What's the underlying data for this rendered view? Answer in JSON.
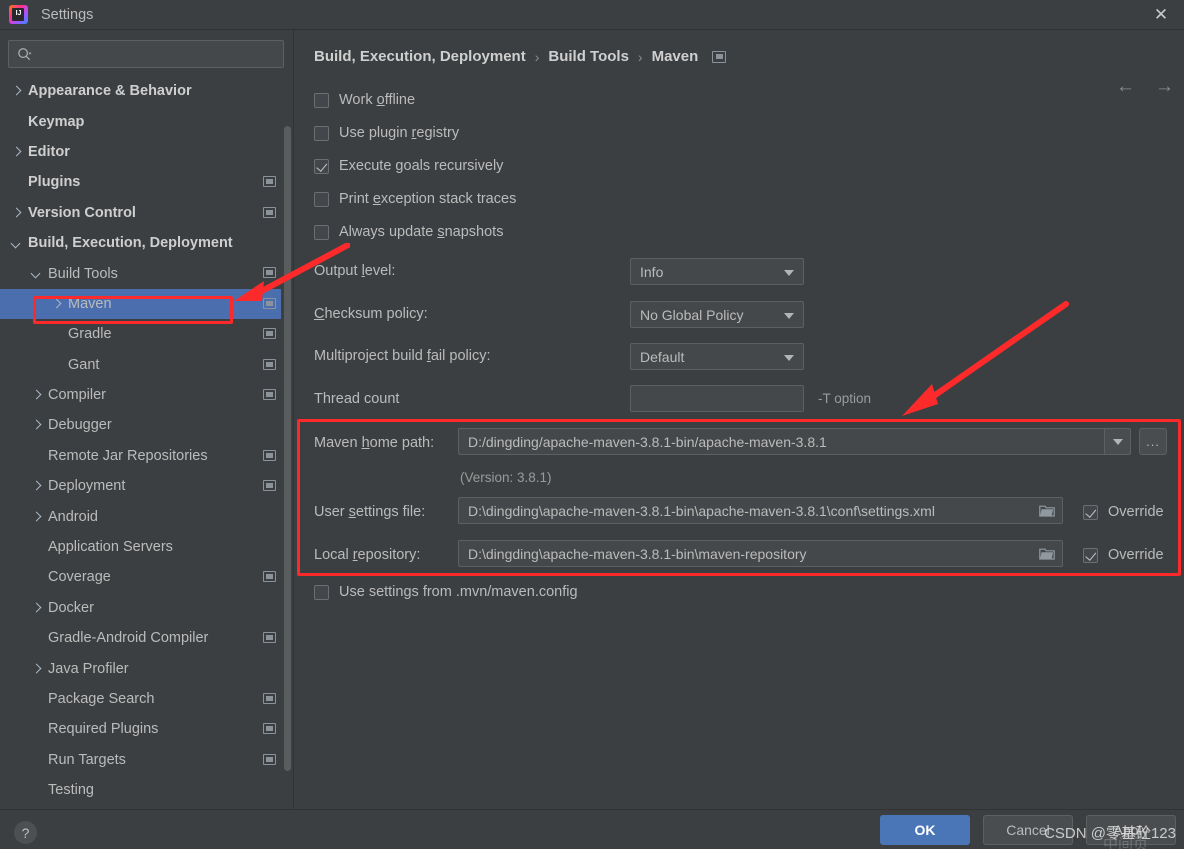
{
  "window": {
    "title": "Settings",
    "logo_text": "IJ",
    "close_label": "✕"
  },
  "sidebar": {
    "search": {
      "value": "",
      "placeholder": ""
    },
    "items": [
      {
        "label": "Appearance & Behavior",
        "indent": 0,
        "chev": "right",
        "bold": true,
        "proj": false,
        "selected": false
      },
      {
        "label": "Keymap",
        "indent": 0,
        "chev": "none",
        "bold": true,
        "proj": false,
        "selected": false
      },
      {
        "label": "Editor",
        "indent": 0,
        "chev": "right",
        "bold": true,
        "proj": false,
        "selected": false
      },
      {
        "label": "Plugins",
        "indent": 0,
        "chev": "none",
        "bold": true,
        "proj": true,
        "selected": false
      },
      {
        "label": "Version Control",
        "indent": 0,
        "chev": "right",
        "bold": true,
        "proj": true,
        "selected": false
      },
      {
        "label": "Build, Execution, Deployment",
        "indent": 0,
        "chev": "down",
        "bold": true,
        "proj": false,
        "selected": false
      },
      {
        "label": "Build Tools",
        "indent": 1,
        "chev": "down",
        "bold": false,
        "proj": true,
        "selected": false
      },
      {
        "label": "Maven",
        "indent": 2,
        "chev": "right",
        "bold": false,
        "proj": true,
        "selected": true
      },
      {
        "label": "Gradle",
        "indent": 2,
        "chev": "none",
        "bold": false,
        "proj": true,
        "selected": false
      },
      {
        "label": "Gant",
        "indent": 2,
        "chev": "none",
        "bold": false,
        "proj": true,
        "selected": false
      },
      {
        "label": "Compiler",
        "indent": 1,
        "chev": "right",
        "bold": false,
        "proj": true,
        "selected": false
      },
      {
        "label": "Debugger",
        "indent": 1,
        "chev": "right",
        "bold": false,
        "proj": false,
        "selected": false
      },
      {
        "label": "Remote Jar Repositories",
        "indent": 1,
        "chev": "none",
        "bold": false,
        "proj": true,
        "selected": false
      },
      {
        "label": "Deployment",
        "indent": 1,
        "chev": "right",
        "bold": false,
        "proj": true,
        "selected": false
      },
      {
        "label": "Android",
        "indent": 1,
        "chev": "right",
        "bold": false,
        "proj": false,
        "selected": false
      },
      {
        "label": "Application Servers",
        "indent": 1,
        "chev": "none",
        "bold": false,
        "proj": false,
        "selected": false
      },
      {
        "label": "Coverage",
        "indent": 1,
        "chev": "none",
        "bold": false,
        "proj": true,
        "selected": false
      },
      {
        "label": "Docker",
        "indent": 1,
        "chev": "right",
        "bold": false,
        "proj": false,
        "selected": false
      },
      {
        "label": "Gradle-Android Compiler",
        "indent": 1,
        "chev": "none",
        "bold": false,
        "proj": true,
        "selected": false
      },
      {
        "label": "Java Profiler",
        "indent": 1,
        "chev": "right",
        "bold": false,
        "proj": false,
        "selected": false
      },
      {
        "label": "Package Search",
        "indent": 1,
        "chev": "none",
        "bold": false,
        "proj": true,
        "selected": false
      },
      {
        "label": "Required Plugins",
        "indent": 1,
        "chev": "none",
        "bold": false,
        "proj": true,
        "selected": false
      },
      {
        "label": "Run Targets",
        "indent": 1,
        "chev": "none",
        "bold": false,
        "proj": true,
        "selected": false
      },
      {
        "label": "Testing",
        "indent": 1,
        "chev": "none",
        "bold": false,
        "proj": false,
        "selected": false
      }
    ]
  },
  "main": {
    "breadcrumb": {
      "part1": "Build, Execution, Deployment",
      "sep1": "›",
      "part2": "Build Tools",
      "sep2": "›",
      "part3": "Maven"
    },
    "nav": {
      "back": "←",
      "forward": "→"
    },
    "checkboxes": [
      {
        "label_pre": "Work ",
        "mnemonic": "o",
        "label_post": "ffline",
        "checked": false
      },
      {
        "label_pre": "Use plugin ",
        "mnemonic": "r",
        "label_post": "egistry",
        "checked": false
      },
      {
        "label_pre": "Execute ",
        "mnemonic": "g",
        "label_post": "oals recursively",
        "checked": true
      },
      {
        "label_pre": "Print ",
        "mnemonic": "e",
        "label_post": "xception stack traces",
        "checked": false
      },
      {
        "label_pre": "Always update ",
        "mnemonic": "s",
        "label_post": "napshots",
        "checked": false
      }
    ],
    "output_level": {
      "label_pre": "Output ",
      "mnemonic": "l",
      "label_post": "evel:",
      "value": "Info"
    },
    "checksum_policy": {
      "label_pre": "",
      "mnemonic": "C",
      "label_post": "hecksum policy:",
      "value": "No Global Policy"
    },
    "fail_policy": {
      "label_pre": "Multiproject build ",
      "mnemonic": "f",
      "label_post": "ail policy:",
      "value": "Default"
    },
    "thread_count": {
      "label": "Thread count",
      "value": "",
      "hint": "-T option"
    },
    "maven_home": {
      "label_pre": "Maven ",
      "mnemonic": "h",
      "label_post": "ome path:",
      "value": "D:/dingding/apache-maven-3.8.1-bin/apache-maven-3.8.1",
      "version_note": "(Version: 3.8.1)",
      "browse_label": "..."
    },
    "user_settings": {
      "label_pre": "User ",
      "mnemonic": "s",
      "label_post": "ettings file:",
      "value": "D:\\dingding\\apache-maven-3.8.1-bin\\apache-maven-3.8.1\\conf\\settings.xml",
      "override_label": "Override",
      "override_checked": true
    },
    "local_repo": {
      "label_pre": "Local ",
      "mnemonic": "r",
      "label_post": "epository:",
      "value": "D:\\dingding\\apache-maven-3.8.1-bin\\maven-repository",
      "override_label": "Override",
      "override_checked": true
    },
    "mvn_config": {
      "label": "Use settings from .mvn/maven.config",
      "checked": false
    }
  },
  "footer": {
    "help_label": "?",
    "ok_label": "OK",
    "cancel_label": "Cancel",
    "apply_label": "Apply"
  },
  "annotations": {
    "watermark": "CSDN @零基砼123",
    "watermark_ghost": "中间页",
    "accent_red": "#fc2a2a",
    "selection_blue": "#4b6eaf"
  }
}
